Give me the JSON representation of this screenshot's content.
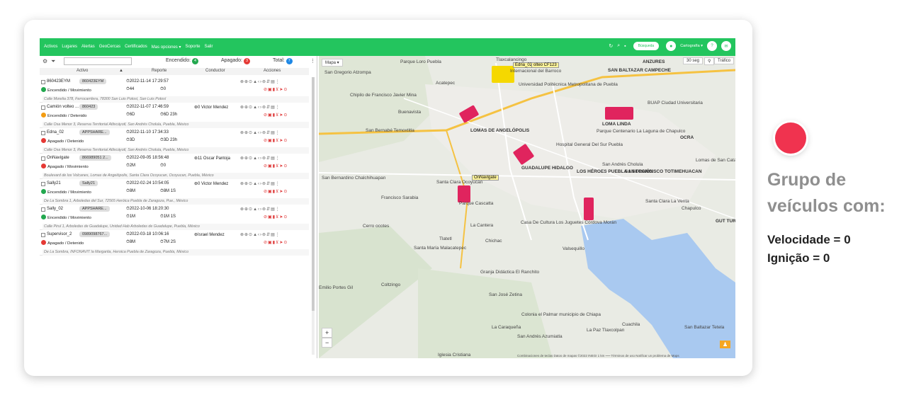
{
  "menu": [
    "Activos",
    "Lugares",
    "Alertas",
    "GeoCercas",
    "Certificados",
    "Mas opciones ▾",
    "Soporte",
    "Salir"
  ],
  "toolbar": {
    "search_button": "Búsqueda",
    "cartography": "Cartografía ▾"
  },
  "summary": {
    "on_label": "Encendido:",
    "on_count": "4",
    "off_label": "Apagado:",
    "off_count": "3",
    "total_label": "Total:",
    "total_count": "7"
  },
  "columns": {
    "asset": "Activo",
    "report": "Reporte",
    "driver": "Conductor",
    "actions": "Acciones"
  },
  "vehicles": [
    {
      "name": "860423EYM",
      "tag": "860423EYM",
      "state": "Encendido / Movimiento",
      "state_color": "#23a84f",
      "report": "2022-11-14 17:29:57",
      "speed": "44",
      "duration": "0",
      "driver": "",
      "address": "Calle Morelia 378, Ferrocarrilera, 78300 San Luis Potosí, San Luis Potosí"
    },
    {
      "name": "Camión volteo ...",
      "tag": "860423",
      "state": "Encendido / Detenido",
      "state_color": "#f39c12",
      "report": "2022-11-07 17:46:59",
      "speed": "6D",
      "duration": "6D 23h",
      "driver": "0 Victor Mendez",
      "address": "Calle Osa Menor 3, Reserva Territorial Atlixcáyotl, San Andrés Cholula, Puebla, México"
    },
    {
      "name": "Edna_02",
      "tag": "APPSHARE...",
      "state": "Apagado / Detenido",
      "state_color": "#e53935",
      "report": "2022-11-10 17:34:33",
      "speed": "3D",
      "duration": "3D 23h",
      "driver": "",
      "address": "Calle Osa Menor 3, Reserva Territorial Atlixcáyotl, San Andrés Cholula, Puebla, México"
    },
    {
      "name": "OnNavigate",
      "tag": "866989051 2...",
      "state": "Apagado / Movimiento",
      "state_color": "#e53935",
      "report": "2022-09-05 18:56:48",
      "speed": "2M",
      "duration": "0",
      "driver": "11 Oscar Pantoja",
      "address": "Boulevard de los Volcanes, Lomas de Angelópolis, Santa Clara Ocoyucan, Ocoyucan, Puebla, México"
    },
    {
      "name": "Sally21",
      "tag": "Sally21",
      "state": "Encendido / Movimiento",
      "state_color": "#23a84f",
      "report": "2022-02-24 10:54:05",
      "speed": "8M",
      "duration": "8M 1S",
      "driver": "0 Victor Mendez",
      "address": "De La Sombra 1, Arboledas del Sur, 72565 Heróica Puebla de Zaragoza, Pue., México"
    },
    {
      "name": "Sally_02",
      "tag": "APPSHARE...",
      "state": "Encendido / Movimiento",
      "state_color": "#23a84f",
      "report": "2022-10-06 18:20:30",
      "speed": "1M",
      "duration": "1M 1S",
      "driver": "",
      "address": "Calle Pirul 1, Arboledas de Guadalupe, Unidad Hab Arboledas de Guadalupe, Puebla, México"
    },
    {
      "name": "Supervisor_2",
      "tag": "0989098767...",
      "state": "Apagado / Detenido",
      "state_color": "#e53935",
      "report": "2022-03-18 10:06:16",
      "speed": "8M",
      "duration": "7M 2S",
      "driver": "Israel Mendez",
      "address": "De La Sombra, INFONAVIT la Margarita, Heroica Puebla de Zaragoza, Puebla, México"
    }
  ],
  "map": {
    "type_button": "Mapa ▾",
    "refresh_button": "30 seg",
    "traffic_button": "Tráfico",
    "footer": "Combinaciones de teclas   Datos de mapas ©2022 INEGI   1 km ⎯⎯⎯   Términos de uso   Notificar un problema de Maps",
    "vehicle_labels": [
      "Edna_02",
      "olteo CF123",
      "OnNavigate"
    ],
    "places": [
      "Tlaxcalancingo",
      "San Gregorio Atzompa",
      "Parque Loro Puebla",
      "Acatepec",
      "Chipilo de Francisco Javier Mina",
      "Buenavista",
      "San Bernabé Temoxtitla",
      "LOMAS DE ANGELÓPOLIS",
      "ANZURES",
      "SAN BALTAZAR CAMPECHE",
      "LOMA LINDA",
      "BUAP Ciudad Universitaria",
      "Parque Centenario La Laguna de Chapulco",
      "Hospital General Del Sur Puebla",
      "GUADALUPE HIDALGO",
      "LOS HÉROES PUEBLA 1 SECCIÓN",
      "SAN FRANCISCO TOTIMEHUACAN",
      "San Bernardino Chalchihuapan",
      "Santa Clara Ocoyucan",
      "Parque Cascatta",
      "Francisco Sarabia",
      "Cerro ocotes",
      "La Cantera",
      "Casa De Cultura Los Juguetes Córdova Morán",
      "Chichac",
      "Valsequillo",
      "Santa Clara La Venta",
      "Chapulco",
      "Lomas de San Catarina",
      "Tlatetl",
      "Santa María Malacatepec",
      "Granja Didáctica El Ranchito",
      "Coltzingo",
      "Emilio Portes Gil",
      "San José Zetina",
      "La Caraqueña",
      "Colonia el Palmar municipio de Chiapa",
      "San Andrés Azumiatla",
      "La Paz Tlaxcolpan",
      "Cuachila",
      "San Baltazar Tetela",
      "Iglesia Cristiana",
      "San Andrés Cholula",
      "Internacional del Barroco",
      "Universidad Politécnica Metropolitana de Puebla",
      "OCRA",
      "GUT TUROKS P"
    ]
  },
  "side": {
    "title": "Grupo de veículos com:",
    "line1": "Velocidade = 0",
    "line2": "Ignição = 0"
  }
}
